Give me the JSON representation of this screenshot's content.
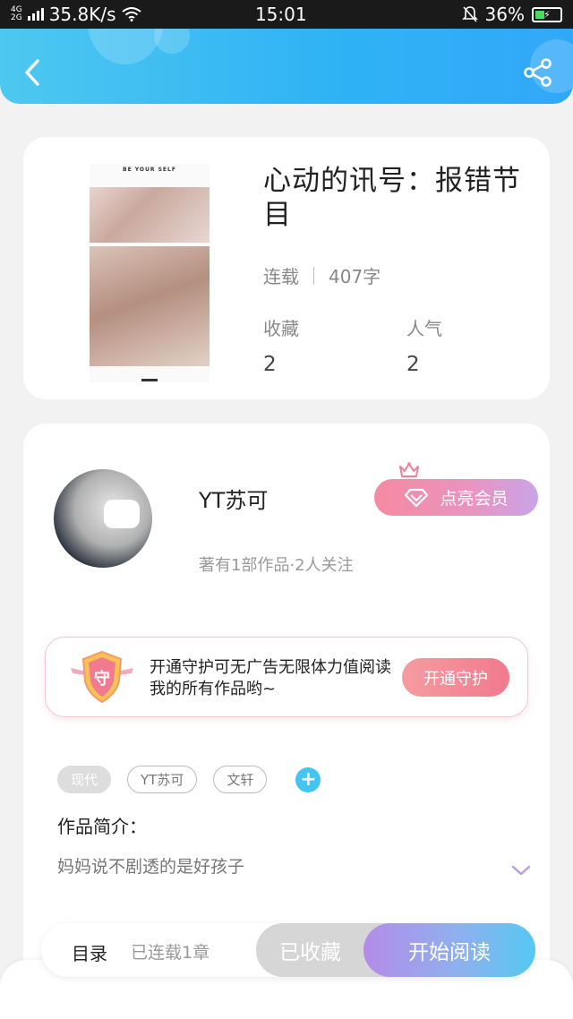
{
  "status_bar": {
    "network_top": "4G",
    "network_bottom": "2G",
    "speed": "35.8K/s",
    "time": "15:01",
    "battery": "36%"
  },
  "colors": {
    "header_start": "#4dc8f0",
    "header_end": "#31a8f7",
    "vip_pink": "#f58aa2",
    "guard_pink": "#f27a8e",
    "read_purple": "#b48ce8",
    "read_blue": "#55c8f3",
    "tag_add_blue": "#44c4f2"
  },
  "book": {
    "cover_text": "BE YOUR SELF",
    "title": "心动的讯号：报错节目",
    "status": "连载",
    "word_count": "407字",
    "collect_label": "收藏",
    "collect_value": "2",
    "popularity_label": "人气",
    "popularity_value": "2"
  },
  "author": {
    "name": "YT苏可",
    "info": "著有1部作品·2人关注",
    "vip_button": "点亮会员"
  },
  "guard": {
    "badge_char": "守",
    "text": "开通守护可无广告无限体力值阅读我的所有作品哟~",
    "button": "开通守护"
  },
  "tags": [
    "现代",
    "YT苏可",
    "文轩"
  ],
  "intro": {
    "label": "作品简介：",
    "text": "妈妈说不剧透的是好孩子"
  },
  "bottom_bar": {
    "toc_label": "目录",
    "toc_count": "已连载1章",
    "collected_label": "已收藏",
    "read_label": "开始阅读"
  }
}
